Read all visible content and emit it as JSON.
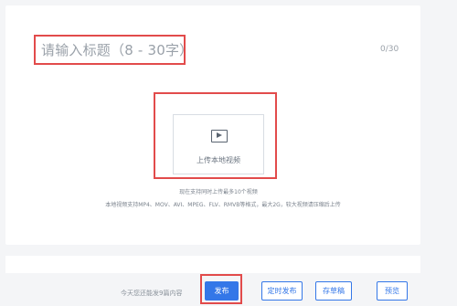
{
  "editor": {
    "title_placeholder": "请输入标题（8 - 30字）",
    "char_count": "0/30"
  },
  "upload": {
    "button_label": "上传本地视频",
    "icon": "play-icon",
    "hint_line1": "现在支持同时上传最多10个视频",
    "hint_line2": "本地视频支持MP4、MOV、AVI、MPEG、FLV、RMVB等格式，最大2G，较大视频请压缩后上传"
  },
  "footer": {
    "remaining_text": "今天您还能发9篇内容",
    "publish_label": "发布",
    "schedule_label": "定时发布",
    "draft_label": "存草稿",
    "preview_label": "预览"
  },
  "colors": {
    "accent": "#3477e8",
    "highlight": "#e24b4b"
  }
}
